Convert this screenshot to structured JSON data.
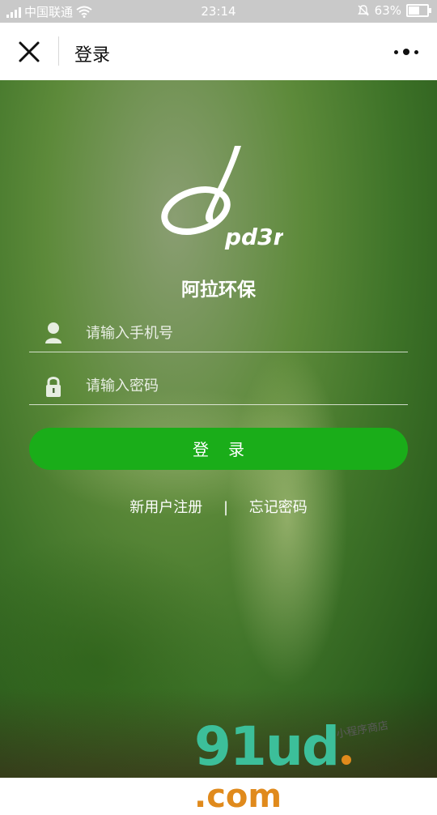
{
  "status_bar": {
    "carrier": "中国联通",
    "time": "23:14",
    "battery_pct": "63%",
    "battery_level": 0.63,
    "icons": [
      "signal-icon",
      "wifi-icon",
      "mute-bell-icon",
      "battery-icon"
    ]
  },
  "nav": {
    "title": "登录",
    "close_icon": "close-icon",
    "more_icon": "more-icon"
  },
  "logo": {
    "text": "pd3r"
  },
  "app_name": "阿拉环保",
  "form": {
    "phone_placeholder": "请输入手机号",
    "password_placeholder": "请输入密码",
    "phone_icon": "user-icon",
    "password_icon": "lock-icon",
    "login_label": "登录"
  },
  "links": {
    "register": "新用户注册",
    "separator": "|",
    "forgot": "忘记密码"
  },
  "watermark": {
    "brand": "91ud",
    "domain": ".com",
    "tagline": "小程序商店"
  },
  "colors": {
    "accent": "#1aad19",
    "statusbar": "#c9c9c9",
    "watermark_teal": "#3cbf9a",
    "watermark_orange": "#e08a1c"
  }
}
